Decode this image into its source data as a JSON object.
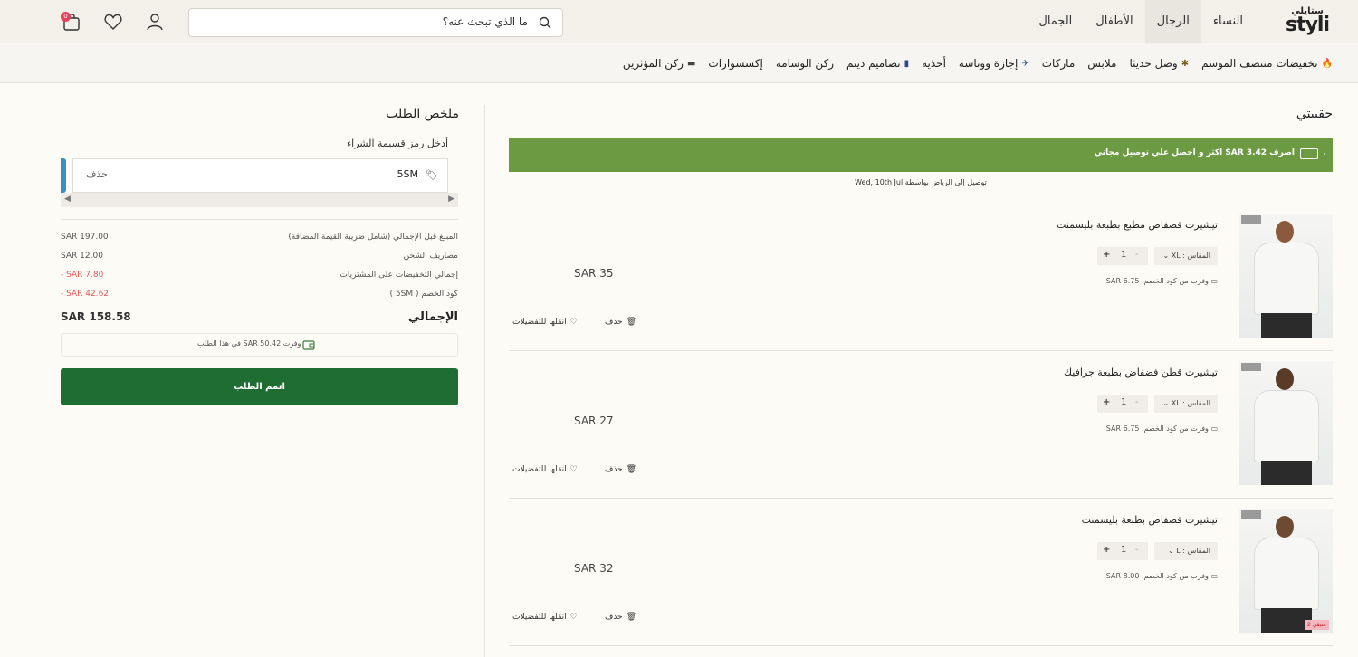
{
  "header": {
    "logo_ar": "ستايلي",
    "logo_en": "styli",
    "tabs": [
      {
        "label": "النساء"
      },
      {
        "label": "الرجال"
      },
      {
        "label": "الأطفال"
      },
      {
        "label": "الجمال"
      }
    ],
    "search_placeholder": "ما الذي تبحث عنه؟",
    "cart_count": "0"
  },
  "subnav": {
    "items": [
      {
        "label": "تخفيضات منتصف الموسم",
        "icon": "fire-icon"
      },
      {
        "label": "وصل حديثا",
        "icon": "sparkle-icon"
      },
      {
        "label": "ملابس"
      },
      {
        "label": "ماركات"
      },
      {
        "label": "إجازة ووناسة",
        "icon": "plane-icon"
      },
      {
        "label": "أحذية"
      },
      {
        "label": "تصاميم دينم",
        "icon": "denim-icon"
      },
      {
        "label": "ركن الوسامة"
      },
      {
        "label": "إكسسوارات"
      },
      {
        "label": "ركن المؤثرين",
        "icon": "card-icon"
      }
    ]
  },
  "summary": {
    "title": "ملخص الطلب",
    "coupon_label": "أدخل رمز قسيمة الشراء",
    "coupon_code": "5SM",
    "remove_label": "حذف",
    "rows": [
      {
        "label": "المبلغ قبل الإجمالي (شامل ضريبة القيمة المضافة)",
        "value": "SAR 197.00",
        "red": false
      },
      {
        "label": "مصاريف الشحن",
        "value": "SAR 12.00",
        "red": false
      },
      {
        "label": "إجمالي التخفيضات على المشتريات",
        "value": "- SAR 7.80",
        "red": true
      },
      {
        "label": "كود الخصم ( 5SM )",
        "value": "- SAR 42.62",
        "red": true
      }
    ],
    "total_label": "الإجمالي",
    "total_value": "SAR 158.58",
    "saved_text": "وفرت SAR 50.42 في هذا الطلب",
    "checkout_label": "اتمم الطلب"
  },
  "bag": {
    "title": "حقيبتي",
    "promo_text": "اصرف SAR 3.42 اكثر و احصل علي توصيل مجاني",
    "delivery_prefix": "توصيل إلى",
    "delivery_city": "الرياض",
    "delivery_suffix": "بواسطة Wed, 10th Jul",
    "items": [
      {
        "name": "تيشيرت فضفاض مطبع بطبعة بليسمنت",
        "size": "المقاس : XL",
        "qty": "1",
        "saving": "وفرت من كود الخصم: SAR 6.75",
        "price": "SAR 35",
        "discount": ""
      },
      {
        "name": "تيشيرت قطن فضفاض بطبعة جرافيك",
        "size": "المقاس : XL",
        "qty": "1",
        "saving": "وفرت من كود الخصم: SAR 6.75",
        "price": "SAR 27",
        "discount": ""
      },
      {
        "name": "تيشيرت فضفاض بطبعة بليسمنت",
        "size": "المقاس : L",
        "qty": "1",
        "saving": "وفرت من كود الخصم: SAR 8.00",
        "price": "SAR 32",
        "discount": "2 متبقي"
      }
    ],
    "delete_label": "حذف",
    "wishlist_label": "انقلها للتفضيلات"
  }
}
